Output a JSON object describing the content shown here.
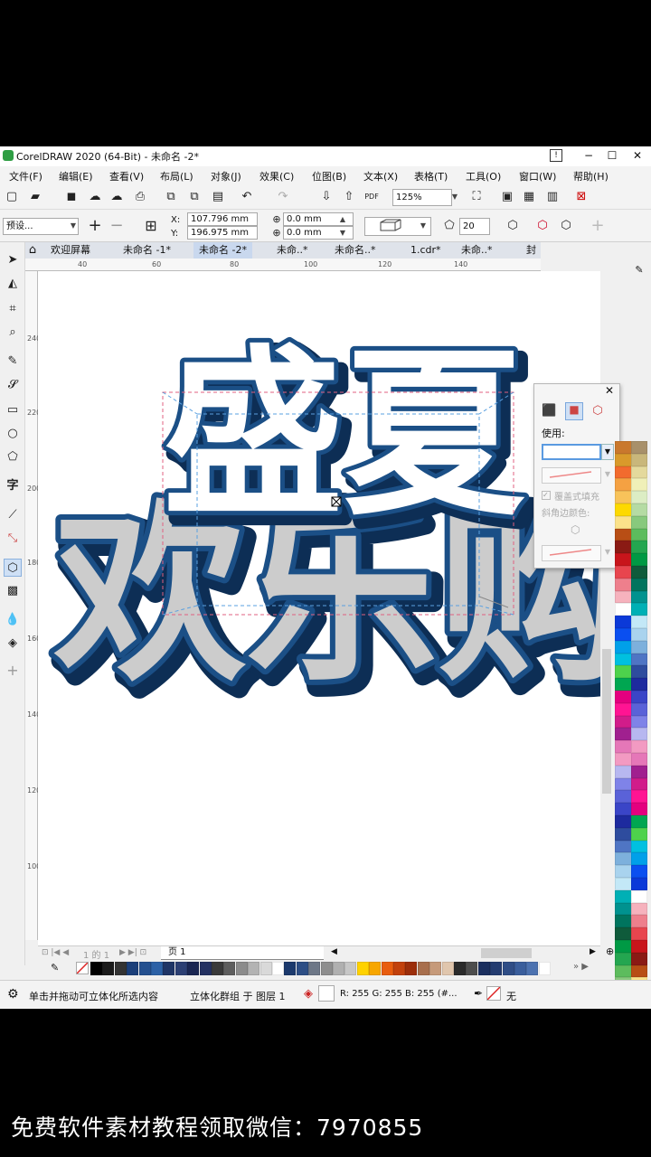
{
  "window": {
    "title": "CorelDRAW 2020 (64-Bit) - 未命名 -2*",
    "controls": [
      "−",
      "☐",
      "✕"
    ]
  },
  "menu": [
    "文件(F)",
    "编辑(E)",
    "查看(V)",
    "布局(L)",
    "对象(J)",
    "效果(C)",
    "位图(B)",
    "文本(X)",
    "表格(T)",
    "工具(O)",
    "窗口(W)",
    "帮助(H)"
  ],
  "toolbar": {
    "zoom": "125%"
  },
  "property_bar": {
    "preset": "预设...",
    "x_label": "X:",
    "x_value": "107.796 mm",
    "y_label": "Y:",
    "y_value": "196.975 mm",
    "vp_x": "0.0 mm",
    "vp_y": "0.0 mm",
    "depth": "20"
  },
  "tabs": [
    "欢迎屏幕",
    "未命名 -1*",
    "未命名 -2*",
    "未命..*",
    "未命名..*",
    "1.cdr*",
    "未命..*",
    "封"
  ],
  "ruler": {
    "h": [
      "40",
      "60",
      "80",
      "100",
      "120",
      "140"
    ],
    "v": [
      "240",
      "220",
      "200",
      "180",
      "160",
      "140",
      "120",
      "100"
    ]
  },
  "popup": {
    "use_label": "使用:",
    "overlay_fill": "覆盖式填充",
    "bevel_color": "斜角边颜色:"
  },
  "canvas": {
    "top_text": "盛夏",
    "bottom_text": "欢乐购"
  },
  "pager": {
    "page_count": "1 的 1",
    "page_tab": "页 1"
  },
  "status": {
    "hint": "单击并拖动可立体化所选内容",
    "object": "立体化群组 于 图层 1",
    "color_info": "R: 255 G: 255 B: 255 (#...",
    "outline": "无"
  },
  "colors": {
    "accent_blue": "#1b4f86",
    "extrude_dark": "#0d2e55",
    "fill_gray": "#cccccc",
    "palette_right": [
      "#c9782d",
      "#d99a2b",
      "#f26b2e",
      "#f5a142",
      "#f8c35a",
      "#fdd900",
      "#fbe28a",
      "#b84e15",
      "#8a1a14",
      "#c8151b",
      "#e8454e",
      "#ee7f8c",
      "#f6b2bd",
      "#ffffff",
      "#0b39d8",
      "#0a4ff0",
      "#00a0e9",
      "#00c0e0",
      "#4ed24c",
      "#00a651",
      "#e4007f",
      "#ff1493",
      "#d11c8a",
      "#a0208f",
      "#e577b8",
      "#f29ac2",
      "#b7b7f0",
      "#7f83e8",
      "#5a62d8",
      "#3a45c7",
      "#1d2a9e",
      "#2e4c9e",
      "#4f75c4",
      "#7db0dc",
      "#a9d3ee",
      "#c3e8f7",
      "#00b0b5",
      "#00928f",
      "#00745e",
      "#0f5b3b",
      "#009944",
      "#24a650",
      "#5dbc5d",
      "#88c97d",
      "#b5dba3",
      "#dcedc4",
      "#f0f0b8",
      "#e4d99c",
      "#c9b77b",
      "#a8906a"
    ],
    "palette_bottom": [
      "#000000",
      "#1a1a1a",
      "#333333",
      "#1b3f7a",
      "#24508f",
      "#2c61a6",
      "#1f3566",
      "#2c3f73",
      "#1a2652",
      "#243161",
      "#3a3a3a",
      "#5e5e5e",
      "#8c8c8c",
      "#b3b3b3",
      "#d9d9d9",
      "#ffffff",
      "#1c3a6d",
      "#2d4e85",
      "#6d7787",
      "#8e8e8e",
      "#b0b0b0",
      "#c7c7c7",
      "#ffd200",
      "#f7a600",
      "#e85d0f",
      "#c2410c",
      "#9c2e0a",
      "#a86f4d",
      "#c69a7a",
      "#e0c6ad",
      "#2b2b2b",
      "#4d4d4d",
      "#1b2f5e",
      "#243c70",
      "#2f4d86",
      "#3a5e9c",
      "#4c72b0",
      "#ffffff"
    ]
  },
  "caption": "免费软件素材教程领取微信：7970855"
}
